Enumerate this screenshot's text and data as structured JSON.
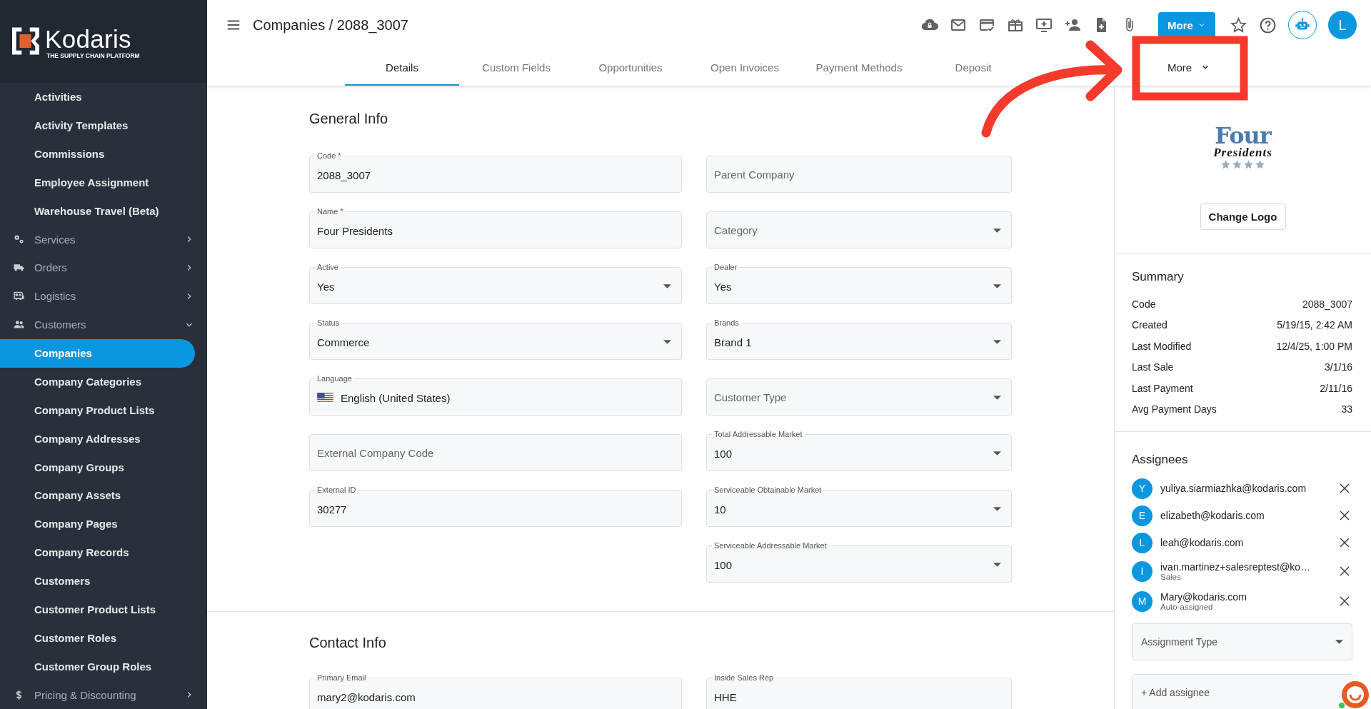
{
  "sidebar": {
    "logo": {
      "name": "Kodaris",
      "tagline": "THE SUPPLY CHAIN PLATFORM"
    },
    "items": [
      {
        "kind": "link",
        "label": "Activities",
        "selected": false
      },
      {
        "kind": "link",
        "label": "Activity Templates",
        "selected": false
      },
      {
        "kind": "link",
        "label": "Commissions",
        "selected": false
      },
      {
        "kind": "link",
        "label": "Employee Assignment",
        "selected": false
      },
      {
        "kind": "link",
        "label": "Warehouse Travel (Beta)",
        "selected": false
      },
      {
        "kind": "section",
        "label": "Services",
        "expanded": false
      },
      {
        "kind": "section",
        "label": "Orders",
        "expanded": false
      },
      {
        "kind": "section",
        "label": "Logistics",
        "expanded": false
      },
      {
        "kind": "section",
        "label": "Customers",
        "expanded": true,
        "children": [
          {
            "kind": "link",
            "label": "Companies",
            "selected": true
          },
          {
            "kind": "link",
            "label": "Company Categories",
            "selected": false
          },
          {
            "kind": "link",
            "label": "Company Product Lists",
            "selected": false
          },
          {
            "kind": "link",
            "label": "Company Addresses",
            "selected": false
          },
          {
            "kind": "link",
            "label": "Company Groups",
            "selected": false
          },
          {
            "kind": "link",
            "label": "Company Assets",
            "selected": false
          },
          {
            "kind": "link",
            "label": "Company Pages",
            "selected": false
          },
          {
            "kind": "link",
            "label": "Company Records",
            "selected": false
          },
          {
            "kind": "link",
            "label": "Customers",
            "selected": false
          },
          {
            "kind": "link",
            "label": "Customer Product Lists",
            "selected": false
          },
          {
            "kind": "link",
            "label": "Customer Roles",
            "selected": false
          },
          {
            "kind": "link",
            "label": "Customer Group Roles",
            "selected": false
          }
        ]
      },
      {
        "kind": "section",
        "label": "Pricing & Discounting",
        "expanded": false
      }
    ]
  },
  "header": {
    "title": "Companies / 2088_3007",
    "more_button": "More",
    "avatar": "L"
  },
  "tabs": [
    {
      "label": "Details",
      "selected": true
    },
    {
      "label": "Custom Fields",
      "selected": false
    },
    {
      "label": "Opportunities",
      "selected": false
    },
    {
      "label": "Open Invoices",
      "selected": false
    },
    {
      "label": "Payment Methods",
      "selected": false
    },
    {
      "label": "Deposit",
      "selected": false
    }
  ],
  "more_tab": {
    "label": "More"
  },
  "sections": [
    {
      "title": "General Info",
      "rows": [
        {
          "left": {
            "kind": "text",
            "label": "Code *",
            "value": "2088_3007"
          },
          "right": {
            "kind": "text",
            "placeholder": "Parent Company"
          }
        },
        {
          "left": {
            "kind": "text",
            "label": "Name *",
            "value": "Four Presidents"
          },
          "right": {
            "kind": "select",
            "placeholder": "Category"
          }
        },
        {
          "left": {
            "kind": "select",
            "label": "Active",
            "value": "Yes"
          },
          "right": {
            "kind": "select",
            "label": "Dealer",
            "value": "Yes"
          }
        },
        {
          "left": {
            "kind": "select",
            "label": "Status",
            "value": "Commerce"
          },
          "right": {
            "kind": "select",
            "label": "Brands",
            "value": "Brand 1"
          }
        },
        {
          "left": {
            "kind": "language",
            "label": "Language",
            "value": "English (United States)"
          },
          "right": {
            "kind": "select",
            "placeholder": "Customer Type"
          }
        },
        {
          "left": {
            "kind": "text",
            "placeholder": "External Company Code"
          },
          "right": {
            "kind": "select",
            "label": "Total Addressable Market",
            "value": "100"
          }
        },
        {
          "left": {
            "kind": "text",
            "label": "External ID",
            "value": "30277"
          },
          "right": {
            "kind": "select",
            "label": "Serviceable Obtainable Market",
            "value": "10"
          }
        },
        {
          "right": {
            "kind": "select",
            "label": "Serviceable Addressable Market",
            "value": "100"
          }
        }
      ]
    },
    {
      "title": "Contact Info",
      "rows": [
        {
          "left": {
            "kind": "text",
            "label": "Primary Email",
            "value": "mary2@kodaris.com"
          },
          "right": {
            "kind": "text",
            "label": "Inside Sales Rep",
            "value": "HHE"
          }
        }
      ]
    }
  ],
  "panel": {
    "logo": {
      "line1": "Four",
      "line2": "Presidents",
      "stars": 4
    },
    "change_logo": "Change Logo",
    "summary": {
      "title": "Summary",
      "rows": [
        {
          "label": "Code",
          "value": "2088_3007"
        },
        {
          "label": "Created",
          "value": "5/19/15, 2:42 AM"
        },
        {
          "label": "Last Modified",
          "value": "12/4/25, 1:00 PM"
        },
        {
          "label": "Last Sale",
          "value": "3/1/16"
        },
        {
          "label": "Last Payment",
          "value": "2/11/16"
        },
        {
          "label": "Avg Payment Days",
          "value": "33"
        }
      ]
    },
    "assignees": {
      "title": "Assignees",
      "items": [
        {
          "initial": "Y",
          "email": "yuliya.siarmiazhka@kodaris.com"
        },
        {
          "initial": "E",
          "email": "elizabeth@kodaris.com"
        },
        {
          "initial": "L",
          "email": "leah@kodaris.com"
        },
        {
          "initial": "I",
          "email": "ivan.martinez+salesreptest@ko…",
          "role": "Sales"
        },
        {
          "initial": "M",
          "email": "Mary@kodaris.com",
          "role": "Auto-assigned"
        }
      ],
      "type_placeholder": "Assignment Type",
      "add_placeholder": "+ Add assignee"
    }
  }
}
